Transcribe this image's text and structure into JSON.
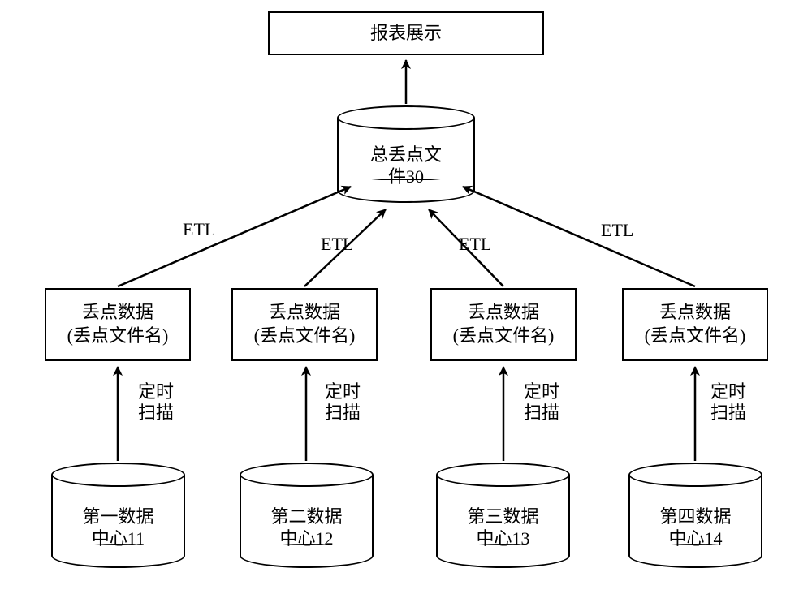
{
  "top_box": {
    "label": "报表展示"
  },
  "central_cylinder": {
    "line1": "总丢点文",
    "line2": "件30"
  },
  "etl_labels": {
    "e1": "ETL",
    "e2": "ETL",
    "e3": "ETL",
    "e4": "ETL"
  },
  "data_boxes": {
    "b1": {
      "l1": "丢点数据",
      "l2": "(丢点文件名)"
    },
    "b2": {
      "l1": "丢点数据",
      "l2": "(丢点文件名)"
    },
    "b3": {
      "l1": "丢点数据",
      "l2": "(丢点文件名)"
    },
    "b4": {
      "l1": "丢点数据",
      "l2": "(丢点文件名)"
    }
  },
  "scan_labels": {
    "s1": {
      "l1": "定时",
      "l2": "扫描"
    },
    "s2": {
      "l1": "定时",
      "l2": "扫描"
    },
    "s3": {
      "l1": "定时",
      "l2": "扫描"
    },
    "s4": {
      "l1": "定时",
      "l2": "扫描"
    }
  },
  "bottom_cylinders": {
    "c1": {
      "l1": "第一数据",
      "l2": "中心11"
    },
    "c2": {
      "l1": "第二数据",
      "l2": "中心12"
    },
    "c3": {
      "l1": "第三数据",
      "l2": "中心13"
    },
    "c4": {
      "l1": "第四数据",
      "l2": "中心14"
    }
  }
}
